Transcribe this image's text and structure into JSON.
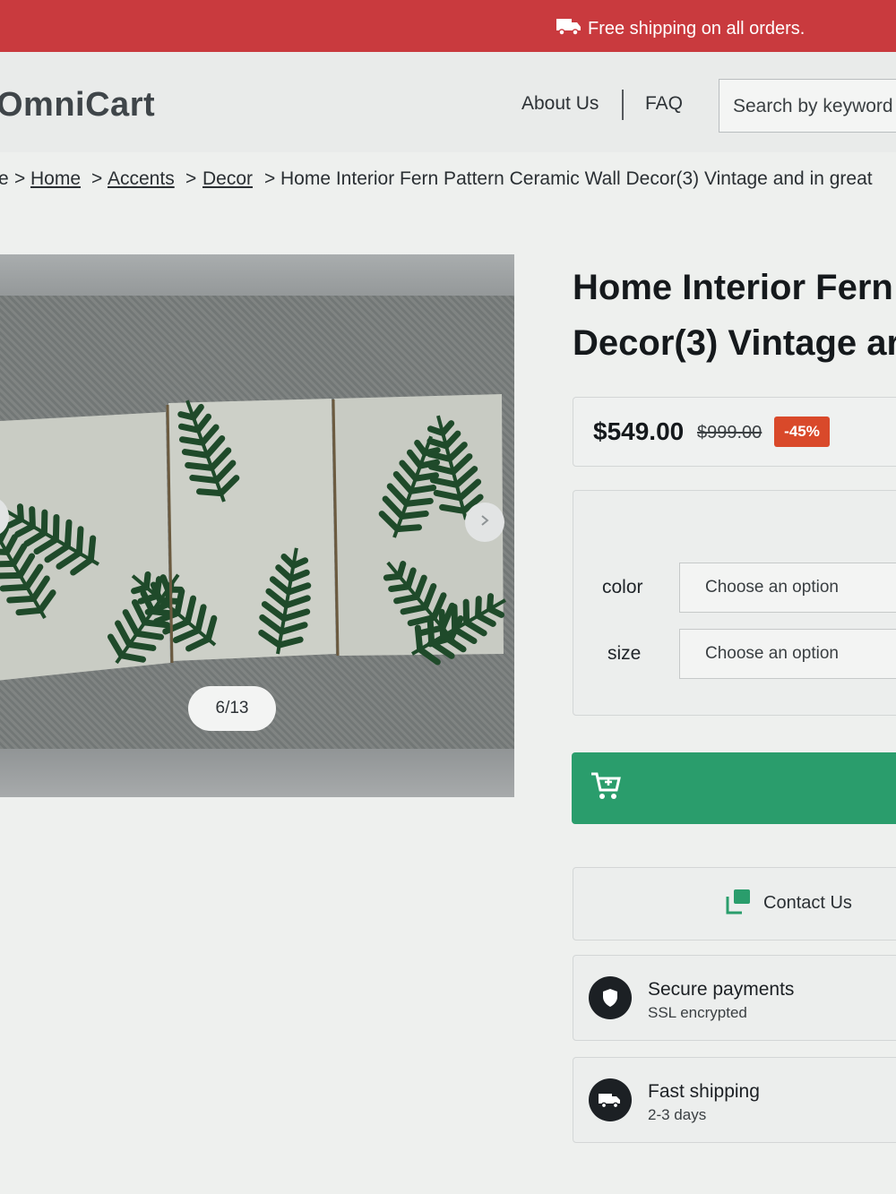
{
  "announcement": {
    "text": "Free shipping on all orders.",
    "icon": "truck-icon"
  },
  "header": {
    "logo": "OmniCart",
    "nav": [
      {
        "label": "About Us"
      },
      {
        "label": "FAQ"
      }
    ],
    "search_placeholder": "Search by keyword"
  },
  "breadcrumb": {
    "first": "e",
    "items": [
      {
        "label": "Home"
      },
      {
        "label": "Accents"
      },
      {
        "label": "Decor"
      }
    ],
    "current": "Home Interior Fern Pattern Ceramic Wall Decor(3) Vintage and in great"
  },
  "gallery": {
    "counter": "6/13"
  },
  "product": {
    "title_line1": "Home Interior Fern",
    "title_line2": "Decor(3) Vintage ar",
    "price": "$549.00",
    "old_price": "$999.00",
    "discount": "-45%",
    "options": [
      {
        "label": "color",
        "value": "Choose an option"
      },
      {
        "label": "size",
        "value": "Choose an option"
      }
    ],
    "contact_label": "Contact Us"
  },
  "features": [
    {
      "title": "Secure payments",
      "subtitle": "SSL encrypted",
      "icon": "shield-icon"
    },
    {
      "title": "Fast shipping",
      "subtitle": "2-3 days",
      "icon": "truck-icon"
    }
  ],
  "colors": {
    "topbar": "#c93a3e",
    "cart_button": "#2a9d6c",
    "discount_badge": "#d9492a"
  }
}
